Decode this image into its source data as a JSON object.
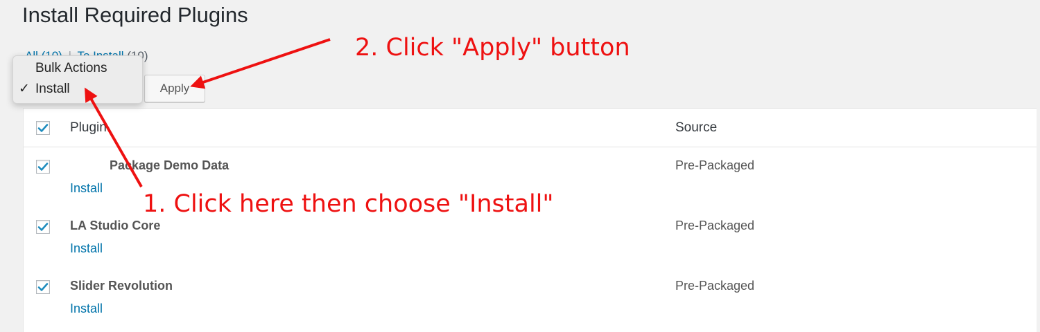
{
  "page": {
    "title": "Install Required Plugins"
  },
  "filters": {
    "all_label": "All (10)",
    "separator": "|",
    "to_install_label": "To Install",
    "to_install_count": "(10)"
  },
  "bulk_actions": {
    "options": [
      {
        "label": "Bulk Actions",
        "selected": false
      },
      {
        "label": "Install",
        "selected": true
      }
    ],
    "check_glyph": "✓",
    "apply_label": "Apply"
  },
  "table": {
    "columns": [
      "Plugin",
      "Source"
    ],
    "header_checked": true,
    "rows": [
      {
        "name": "Package Demo Data",
        "action": "Install",
        "source": "Pre-Packaged",
        "checked": true
      },
      {
        "name": "LA Studio Core",
        "action": "Install",
        "source": "Pre-Packaged",
        "checked": true
      },
      {
        "name": "Slider Revolution",
        "action": "Install",
        "source": "Pre-Packaged",
        "checked": true
      }
    ]
  },
  "annotations": {
    "step1": "1. Click here then choose \"Install\"",
    "step2": "2. Click \"Apply\" button",
    "color": "#ee1111"
  },
  "colors": {
    "link": "#0073aa",
    "checkbox_check": "#1e8cbe",
    "background": "#f1f1f1"
  }
}
